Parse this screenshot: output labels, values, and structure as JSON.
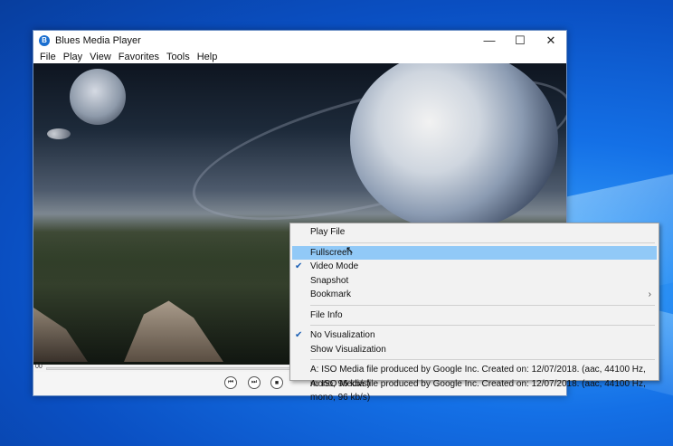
{
  "window": {
    "title": "Blues Media Player",
    "app_icon": "B",
    "controls": {
      "minimize": "—",
      "maximize": "☐",
      "close": "✕"
    }
  },
  "menubar": {
    "items": [
      "File",
      "Play",
      "View",
      "Favorites",
      "Tools",
      "Help"
    ]
  },
  "seekbar": {
    "time": "00"
  },
  "transport": {
    "prev_icon": "⏮",
    "next_icon": "⏭",
    "stop_icon": "■"
  },
  "context_menu": {
    "items": [
      {
        "label": "Play File",
        "checked": false,
        "submenu": false
      },
      {
        "separator": true
      },
      {
        "label": "Fullscreen",
        "checked": false,
        "submenu": false,
        "hovered": true
      },
      {
        "label": "Video Mode",
        "checked": true,
        "submenu": false
      },
      {
        "label": "Snapshot",
        "checked": false,
        "submenu": false
      },
      {
        "label": "Bookmark",
        "checked": false,
        "submenu": true
      },
      {
        "separator": true
      },
      {
        "label": "File Info",
        "checked": false,
        "submenu": false
      },
      {
        "separator": true
      },
      {
        "label": "No Visualization",
        "checked": true,
        "submenu": false
      },
      {
        "label": "Show Visualization",
        "checked": false,
        "submenu": false
      },
      {
        "separator": true
      },
      {
        "label": "A: ISO Media file produced by Google Inc. Created on: 12/07/2018. (aac, 44100 Hz, mono, 96 kb/s)",
        "checked": false,
        "submenu": false
      },
      {
        "label": "A: ISO Media file produced by Google Inc. Created on: 12/07/2018. (aac, 44100 Hz, mono, 96 kb/s)",
        "checked": false,
        "submenu": false
      }
    ],
    "check_glyph": "✔",
    "submenu_glyph": "›"
  }
}
